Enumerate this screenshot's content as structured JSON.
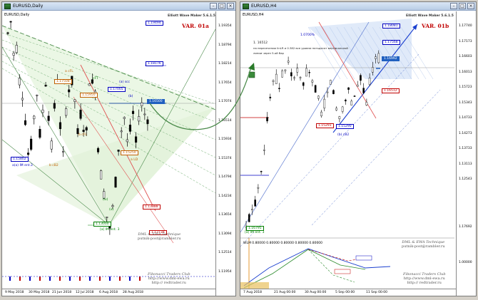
{
  "left_window": {
    "title": "EURUSD,Daily",
    "symbol": "EURUSD,Daily",
    "indicator": "Elliott Wave Maker 5.6.1.5",
    "variant": "VAR. 01a",
    "price_axis": [
      "1.19354",
      "1.18794",
      "1.18214",
      "1.17654",
      "1.17074",
      "1.16514",
      "1.15934",
      "1.15374",
      "1.14794",
      "1.14234",
      "1.13654",
      "1.13094",
      "1.12514",
      "1.11954"
    ],
    "time_axis": [
      "9 May 2018",
      "30 May 2018",
      "21 Jun 2018",
      "12 Jul 2018",
      "6 Aug 2018",
      "28 Aug 2018"
    ],
    "price_tags": [
      {
        "text": "1.19494",
        "color": "#0000c0"
      },
      {
        "text": "1.18176",
        "color": "#0000c0"
      },
      {
        "text": "1.17005",
        "color": "#0000c0"
      },
      {
        "text": "1.16500",
        "color": "#0000c0"
      },
      {
        "text": "1.15802",
        "color": "#0000c0"
      },
      {
        "text": "1.13888",
        "color": "#c00000"
      },
      {
        "text": "1.12738",
        "color": "#c00000"
      },
      {
        "text": "1.13000",
        "color": "#008000"
      },
      {
        "text": "1.17508",
        "color": "#c06000"
      },
      {
        "text": "1.15950",
        "color": "#c06000"
      },
      {
        "text": "1.15250",
        "color": "#c06000"
      }
    ],
    "wave_labels": [
      {
        "text": "a(a) IM ent.3",
        "color": "#0000c0"
      },
      {
        "text": "b cB2",
        "color": "#c06000"
      },
      {
        "text": "(a) scc",
        "color": "#0000c0"
      },
      {
        "text": "(b)",
        "color": "#0000c0"
      },
      {
        "text": "a cFL",
        "color": "#c06000"
      },
      {
        "text": "b cFL",
        "color": "#c06000"
      },
      {
        "text": "a LD",
        "color": "#c06000"
      },
      {
        "text": "(iv)",
        "color": "#008000"
      },
      {
        "text": "(v)",
        "color": "#008000"
      },
      {
        "text": "[a] IM ent. 3",
        "color": "#008000"
      },
      {
        "text": "cFT",
        "color": "#008000"
      }
    ],
    "technique": "DML & EWA Technique",
    "email": "putnik-post@rambler.ru",
    "club_line1": "Fibonacci Traders Club",
    "club_line2": "http://www.dml-ewa.ru",
    "club_line3": "http:// redtrader.ru"
  },
  "right_window": {
    "title": "EURUSD,H4",
    "symbol": "EURUSD,H4",
    "indicator": "Elliott Wave Maker 5.6.1.5",
    "variant": "VAR. 01b",
    "note_line1": "1. 16512",
    "note_line2": "на пересечении linLR и 0.382 все уровни пятьдесят вертикальной",
    "note_line3": "линии через 5-ой бар",
    "price_axis": [
      "1.17740",
      "1.17173",
      "1.16603",
      "1.16013",
      "1.15723",
      "1.15343",
      "1.14733",
      "1.14273",
      "1.13733",
      "1.13113",
      "1.12543"
    ],
    "osc_axis": [
      "1.17692",
      "1.00000"
    ],
    "time_axis": [
      "7 Aug 2018",
      "21 Aug 00:00",
      "30 Aug 00:00",
      "5 Sep 00:00",
      "11 Sep 00:00"
    ],
    "price_tags": [
      {
        "text": "1.18081",
        "color": "#0000c0"
      },
      {
        "text": "1.17568",
        "color": "#0000c0"
      },
      {
        "text": "1.16992",
        "color": "#0000c0"
      },
      {
        "text": "1.16512",
        "color": "#c00000"
      },
      {
        "text": "1.15291",
        "color": "#c00000"
      },
      {
        "text": "1.15290",
        "color": "#0000c0"
      },
      {
        "text": "1.16795",
        "color": "#008000"
      }
    ],
    "wave_labels": [
      {
        "text": "(b) cB2",
        "color": "#0000c0"
      },
      {
        "text": "[a] IM ent. 3",
        "color": "#008000"
      },
      {
        "text": "1.0700%",
        "color": "#0000c0"
      }
    ],
    "osc_label": "WLM 0.80000 0.80000 0.80000 0.80000 0.80000",
    "technique": "DML & EWA Technique",
    "email": "putnik-post@rambler.ru",
    "club_line1": "Fibonacci Traders Club",
    "club_line2": "http://www.dml-ewa.ru",
    "club_line3": "http:// redtrader.ru"
  }
}
